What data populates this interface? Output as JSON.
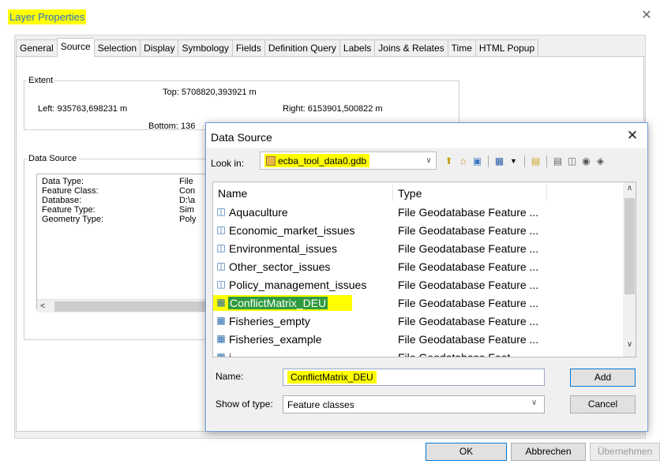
{
  "window": {
    "title": "Layer Properties",
    "close_glyph": "✕"
  },
  "tabs": [
    {
      "label": "General",
      "active": false
    },
    {
      "label": "Source",
      "active": true
    },
    {
      "label": "Selection",
      "active": false
    },
    {
      "label": "Display",
      "active": false
    },
    {
      "label": "Symbology",
      "active": false
    },
    {
      "label": "Fields",
      "active": false
    },
    {
      "label": "Definition Query",
      "active": false
    },
    {
      "label": "Labels",
      "active": false
    },
    {
      "label": "Joins & Relates",
      "active": false
    },
    {
      "label": "Time",
      "active": false
    },
    {
      "label": "HTML Popup",
      "active": false
    }
  ],
  "extent": {
    "label": "Extent",
    "top": "Top:  5708820,393921 m",
    "left": "Left:  935763,698231 m",
    "right": "Right:  6153901,500822 m",
    "bottom": "Bottom:  136"
  },
  "data_source": {
    "label": "Data Source",
    "rows": [
      {
        "key": "Data Type:",
        "value": "File"
      },
      {
        "key": "Feature Class:",
        "value": "Con"
      },
      {
        "key": "Database:",
        "value": "D:\\a"
      },
      {
        "key": "Feature Type:",
        "value": "Sim"
      },
      {
        "key": "Geometry Type:",
        "value": "Poly"
      }
    ],
    "scroll_left_glyph": "<"
  },
  "footer": {
    "ok": "OK",
    "cancel": "Abbrechen",
    "apply": "Übernehmen"
  },
  "dialog": {
    "title": "Data Source",
    "close_glyph": "✕",
    "look_in_label": "Look in:",
    "look_in_value": "ecba_tool_data0.gdb",
    "columns": {
      "name": "Name",
      "type": "Type"
    },
    "items": [
      {
        "name": "Aquaculture",
        "type": "File Geodatabase Feature ...",
        "icon": "feature-dataset-icon",
        "selected": false
      },
      {
        "name": "Economic_market_issues",
        "type": "File Geodatabase Feature ...",
        "icon": "feature-dataset-icon",
        "selected": false
      },
      {
        "name": "Environmental_issues",
        "type": "File Geodatabase Feature ...",
        "icon": "feature-dataset-icon",
        "selected": false
      },
      {
        "name": "Other_sector_issues",
        "type": "File Geodatabase Feature ...",
        "icon": "feature-dataset-icon",
        "selected": false
      },
      {
        "name": "Policy_management_issues",
        "type": "File Geodatabase Feature ...",
        "icon": "feature-dataset-icon",
        "selected": false
      },
      {
        "name": "ConflictMatrix_DEU",
        "type": "File Geodatabase Feature ...",
        "icon": "polygon-feature-class-icon",
        "selected": true
      },
      {
        "name": "Fisheries_empty",
        "type": "File Geodatabase Feature ...",
        "icon": "polygon-feature-class-icon",
        "selected": false
      },
      {
        "name": "Fisheries_example",
        "type": "File Geodatabase Feature ...",
        "icon": "polygon-feature-class-icon",
        "selected": false
      },
      {
        "name": "i",
        "type": "File Geodatabase Feat",
        "icon": "polygon-feature-class-icon",
        "selected": false
      }
    ],
    "name_label": "Name:",
    "name_value": "ConflictMatrix_DEU",
    "show_type_label": "Show of type:",
    "show_type_value": "Feature classes",
    "add_button": "Add",
    "cancel_button": "Cancel",
    "accent_highlight": "#ffff00",
    "selection_color": "#2e9a3e"
  }
}
